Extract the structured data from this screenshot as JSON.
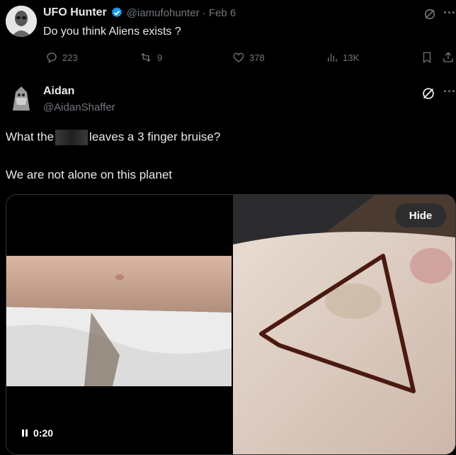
{
  "tweet1": {
    "display_name": "UFO Hunter",
    "handle_date": "@iamufohunter · Feb 6",
    "text": "Do you think Aliens exists ?",
    "replies": "223",
    "retweets": "9",
    "likes": "378",
    "views": "13K"
  },
  "tweet2": {
    "display_name": "Aidan",
    "handle": "@AidanShaffer",
    "line1_before": "What the",
    "line1_after": "leaves a 3 finger bruise?",
    "line2": "We are not alone on this planet"
  },
  "media": {
    "hide_label": "Hide",
    "video_time": "0:20"
  },
  "colors": {
    "verified": "#1d9bf0",
    "muted": "#71767b",
    "text": "#e7e9ea"
  }
}
